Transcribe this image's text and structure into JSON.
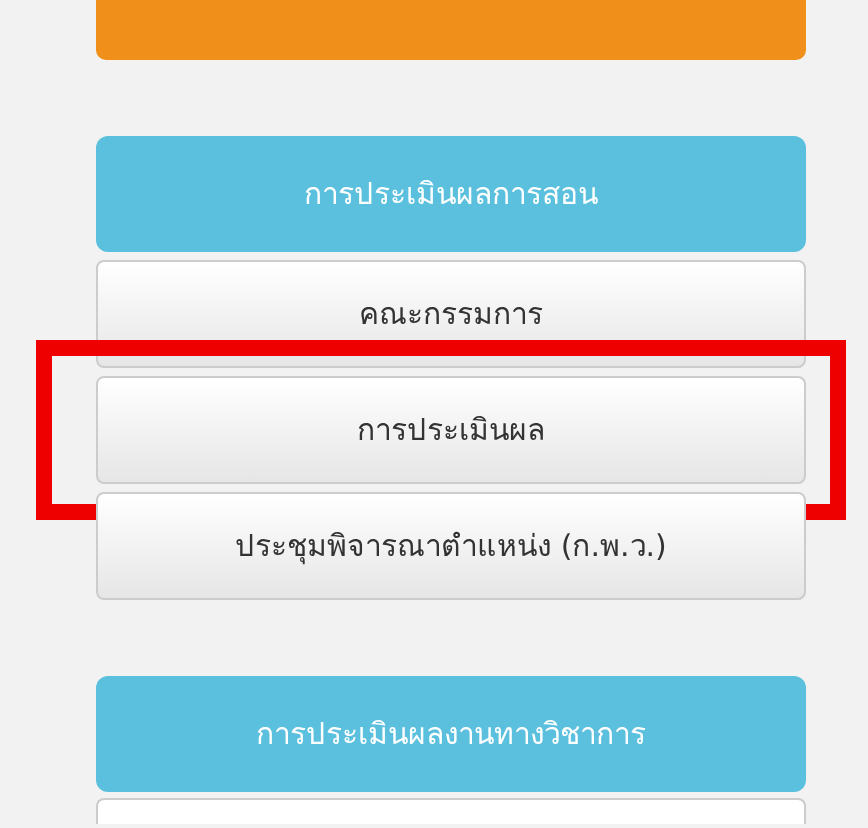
{
  "sections": [
    {
      "kind": "orange"
    },
    {
      "kind": "blue",
      "title": "การประเมินผลการสอน",
      "items": [
        {
          "label": "คณะกรรมการ",
          "highlighted": false
        },
        {
          "label": "การประเมินผล",
          "highlighted": true
        },
        {
          "label": "ประชุมพิจารณาตำแหน่ง (ก.พ.ว.)",
          "highlighted": false
        }
      ]
    },
    {
      "kind": "blue",
      "title": "การประเมินผลงานทางวิชาการ",
      "cut": true
    }
  ]
}
